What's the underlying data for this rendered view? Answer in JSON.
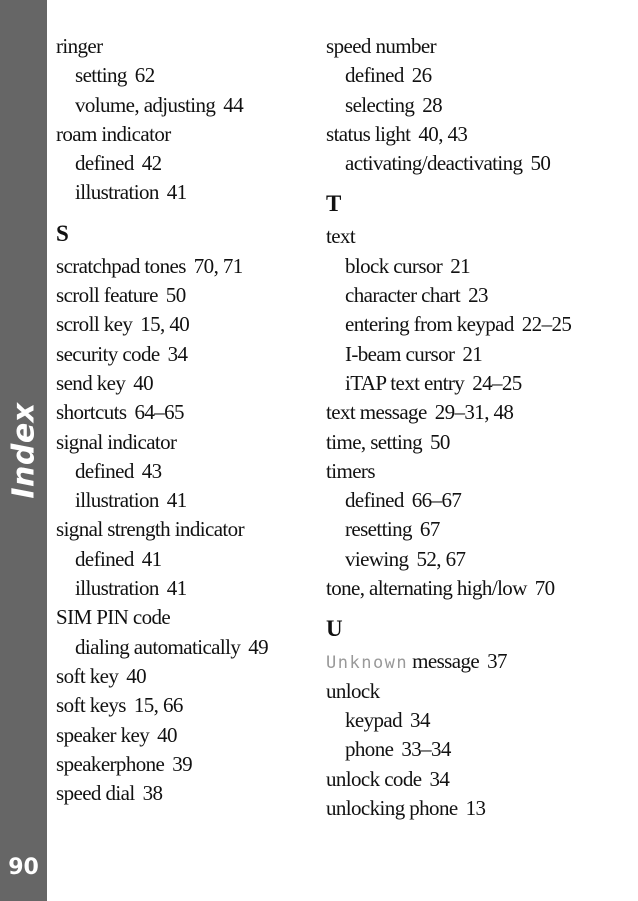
{
  "sidebar": {
    "section_label": "Index",
    "page_number": "90",
    "background_color": "#666666"
  },
  "left_column": [
    {
      "type": "entry",
      "level": 0,
      "term": "ringer",
      "pages": ""
    },
    {
      "type": "entry",
      "level": 1,
      "term": "setting",
      "pages": "62"
    },
    {
      "type": "entry",
      "level": 1,
      "term": "volume, adjusting",
      "pages": "44"
    },
    {
      "type": "entry",
      "level": 0,
      "term": "roam indicator",
      "pages": ""
    },
    {
      "type": "entry",
      "level": 1,
      "term": "defined",
      "pages": "42"
    },
    {
      "type": "entry",
      "level": 1,
      "term": "illustration",
      "pages": "41"
    },
    {
      "type": "letter",
      "term": "S"
    },
    {
      "type": "entry",
      "level": 0,
      "term": "scratchpad tones",
      "pages": "70, 71"
    },
    {
      "type": "entry",
      "level": 0,
      "term": "scroll feature",
      "pages": "50"
    },
    {
      "type": "entry",
      "level": 0,
      "term": "scroll key",
      "pages": "15, 40"
    },
    {
      "type": "entry",
      "level": 0,
      "term": "security code",
      "pages": "34"
    },
    {
      "type": "entry",
      "level": 0,
      "term": "send key",
      "pages": "40"
    },
    {
      "type": "entry",
      "level": 0,
      "term": "shortcuts",
      "pages": "64–65"
    },
    {
      "type": "entry",
      "level": 0,
      "term": "signal indicator",
      "pages": ""
    },
    {
      "type": "entry",
      "level": 1,
      "term": "defined",
      "pages": "43"
    },
    {
      "type": "entry",
      "level": 1,
      "term": "illustration",
      "pages": "41"
    },
    {
      "type": "entry",
      "level": 0,
      "term": "signal strength indicator",
      "pages": ""
    },
    {
      "type": "entry",
      "level": 1,
      "term": "defined",
      "pages": "41"
    },
    {
      "type": "entry",
      "level": 1,
      "term": "illustration",
      "pages": "41"
    },
    {
      "type": "entry",
      "level": 0,
      "term": "SIM PIN code",
      "pages": ""
    },
    {
      "type": "entry",
      "level": 1,
      "term": "dialing automatically",
      "pages": "49"
    },
    {
      "type": "entry",
      "level": 0,
      "term": "soft key",
      "pages": "40"
    },
    {
      "type": "entry",
      "level": 0,
      "term": "soft keys",
      "pages": "15, 66"
    },
    {
      "type": "entry",
      "level": 0,
      "term": "speaker key",
      "pages": "40"
    },
    {
      "type": "entry",
      "level": 0,
      "term": "speakerphone",
      "pages": "39"
    },
    {
      "type": "entry",
      "level": 0,
      "term": "speed dial",
      "pages": "38"
    }
  ],
  "right_column": [
    {
      "type": "entry",
      "level": 0,
      "term": "speed number",
      "pages": ""
    },
    {
      "type": "entry",
      "level": 1,
      "term": "defined",
      "pages": "26"
    },
    {
      "type": "entry",
      "level": 1,
      "term": "selecting",
      "pages": "28"
    },
    {
      "type": "entry",
      "level": 0,
      "term": "status light",
      "pages": "40, 43"
    },
    {
      "type": "entry",
      "level": 1,
      "term": "activating/deactivating",
      "pages": "50"
    },
    {
      "type": "letter",
      "term": "T"
    },
    {
      "type": "entry",
      "level": 0,
      "term": "text",
      "pages": ""
    },
    {
      "type": "entry",
      "level": 1,
      "term": "block cursor",
      "pages": "21"
    },
    {
      "type": "entry",
      "level": 1,
      "term": "character chart",
      "pages": "23"
    },
    {
      "type": "entry",
      "level": 1,
      "term": "entering from keypad",
      "pages": "22–25"
    },
    {
      "type": "entry",
      "level": 1,
      "term": "I-beam cursor",
      "pages": "21"
    },
    {
      "type": "entry",
      "level": 1,
      "term": "iTAP text entry",
      "pages": "24–25"
    },
    {
      "type": "entry",
      "level": 0,
      "term": "text message",
      "pages": "29–31, 48"
    },
    {
      "type": "entry",
      "level": 0,
      "term": "time, setting",
      "pages": "50"
    },
    {
      "type": "entry",
      "level": 0,
      "term": "timers",
      "pages": ""
    },
    {
      "type": "entry",
      "level": 1,
      "term": "defined",
      "pages": "66–67"
    },
    {
      "type": "entry",
      "level": 1,
      "term": "resetting",
      "pages": "67"
    },
    {
      "type": "entry",
      "level": 1,
      "term": "viewing",
      "pages": "52, 67"
    },
    {
      "type": "entry",
      "level": 0,
      "term": "tone, alternating high/low",
      "pages": "70"
    },
    {
      "type": "letter",
      "term": "U"
    },
    {
      "type": "entry",
      "level": 0,
      "display_prefix": "Unknown",
      "term": "message",
      "pages": "37"
    },
    {
      "type": "entry",
      "level": 0,
      "term": "unlock",
      "pages": ""
    },
    {
      "type": "entry",
      "level": 1,
      "term": "keypad",
      "pages": "34"
    },
    {
      "type": "entry",
      "level": 1,
      "term": "phone",
      "pages": "33–34"
    },
    {
      "type": "entry",
      "level": 0,
      "term": "unlock code",
      "pages": "34"
    },
    {
      "type": "entry",
      "level": 0,
      "term": "unlocking phone",
      "pages": "13"
    }
  ]
}
